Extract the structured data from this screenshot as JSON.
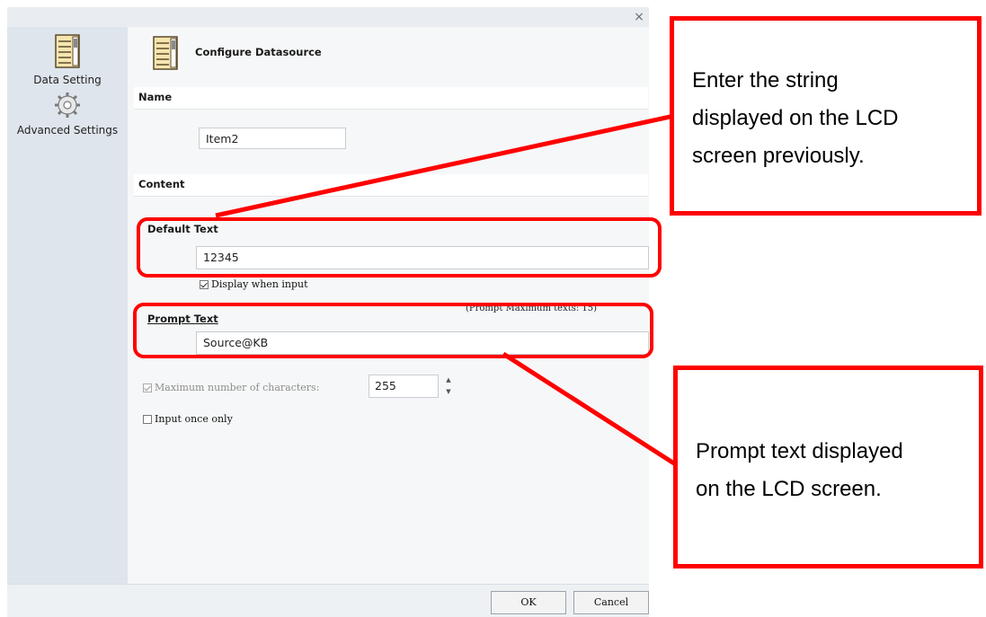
{
  "window": {
    "close_glyph": "×"
  },
  "sidebar": {
    "items": [
      {
        "label": "Data Setting",
        "icon": "list-document-icon"
      },
      {
        "label": "Advanced Settings",
        "icon": "gear-icon"
      }
    ]
  },
  "header": {
    "title": "Configure Datasource",
    "icon": "list-document-icon"
  },
  "name_section": {
    "title": "Name",
    "value": "Item2"
  },
  "content_section": {
    "title": "Content",
    "default_text": {
      "label": "Default Text",
      "value": "12345"
    },
    "display_when_input": {
      "label": "Display when input",
      "checked": true
    },
    "prompt_text": {
      "label": "Prompt Text",
      "max_note": "(Prompt Maximum texts: 15)",
      "value": "Source@KB"
    },
    "max_chars": {
      "label": "Maximum number of characters:",
      "checked": true,
      "disabled": true,
      "value": "255"
    },
    "input_once": {
      "label": "Input once only",
      "checked": false
    }
  },
  "footer": {
    "ok_label": "OK",
    "cancel_label": "Cancel"
  },
  "annotations": {
    "callout_top": {
      "lines": [
        "Enter the string",
        "displayed on the LCD",
        "screen previously."
      ]
    },
    "callout_bottom": {
      "lines": [
        "Prompt text displayed",
        "on the LCD screen."
      ]
    },
    "color": "#ff0000"
  }
}
